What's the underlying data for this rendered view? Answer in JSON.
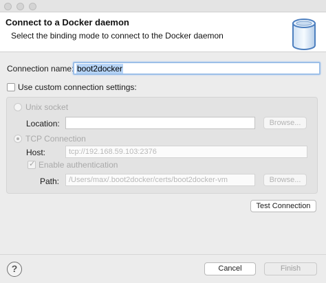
{
  "header": {
    "title": "Connect to a Docker daemon",
    "description": "Select the binding mode to connect to the Docker daemon",
    "icon": "docker-database-icon"
  },
  "form": {
    "connection_name_label": "Connection name:",
    "connection_name_value": "boot2docker",
    "custom_settings_label": "Use custom connection settings:",
    "custom_settings_checked": false
  },
  "unix_socket": {
    "label": "Unix socket",
    "location_label": "Location:",
    "location_value": "",
    "browse_label": "Browse..."
  },
  "tcp": {
    "label": "TCP Connection",
    "selected": true,
    "host_label": "Host:",
    "host_value": "tcp://192.168.59.103:2376",
    "enable_auth_label": "Enable authentication",
    "enable_auth_checked": true,
    "path_label": "Path:",
    "path_value": "/Users/max/.boot2docker/certs/boot2docker-vm",
    "browse_label": "Browse..."
  },
  "actions": {
    "test_connection": "Test Connection",
    "cancel": "Cancel",
    "finish": "Finish",
    "help_icon": "question-mark-icon"
  }
}
